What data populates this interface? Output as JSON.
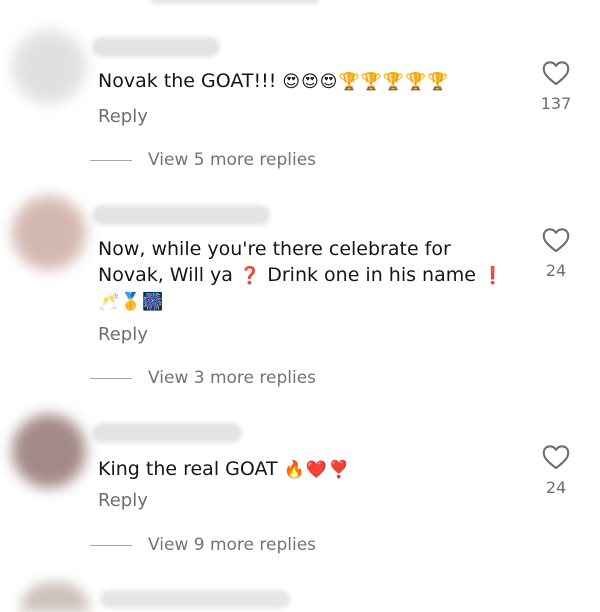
{
  "comments": [
    {
      "text": "Novak the GOAT!!!",
      "emojis": "😍😍😍🏆🏆🏆🏆🏆",
      "reply_label": "Reply",
      "likes": "137",
      "view_more": "View 5 more replies"
    },
    {
      "text_line1": "Now, while you're there celebrate for",
      "text_line2_a": "Novak, Will ya",
      "text_line2_q": "❓",
      "text_line2_b": "Drink one in his name",
      "text_line2_ex": "❗",
      "emojis_line3": "🥂🥇🎆",
      "reply_label": "Reply",
      "likes": "24",
      "view_more": "View 3 more replies"
    },
    {
      "text": "King the real GOAT",
      "emojis": "🔥❤️❣️",
      "reply_label": "Reply",
      "likes": "24",
      "view_more": "View 9 more replies"
    }
  ],
  "icons": {
    "like": "heart-outline-icon"
  },
  "colors": {
    "text": "#151515",
    "secondary": "#6f6f6f",
    "divider": "#a6a6a6"
  }
}
